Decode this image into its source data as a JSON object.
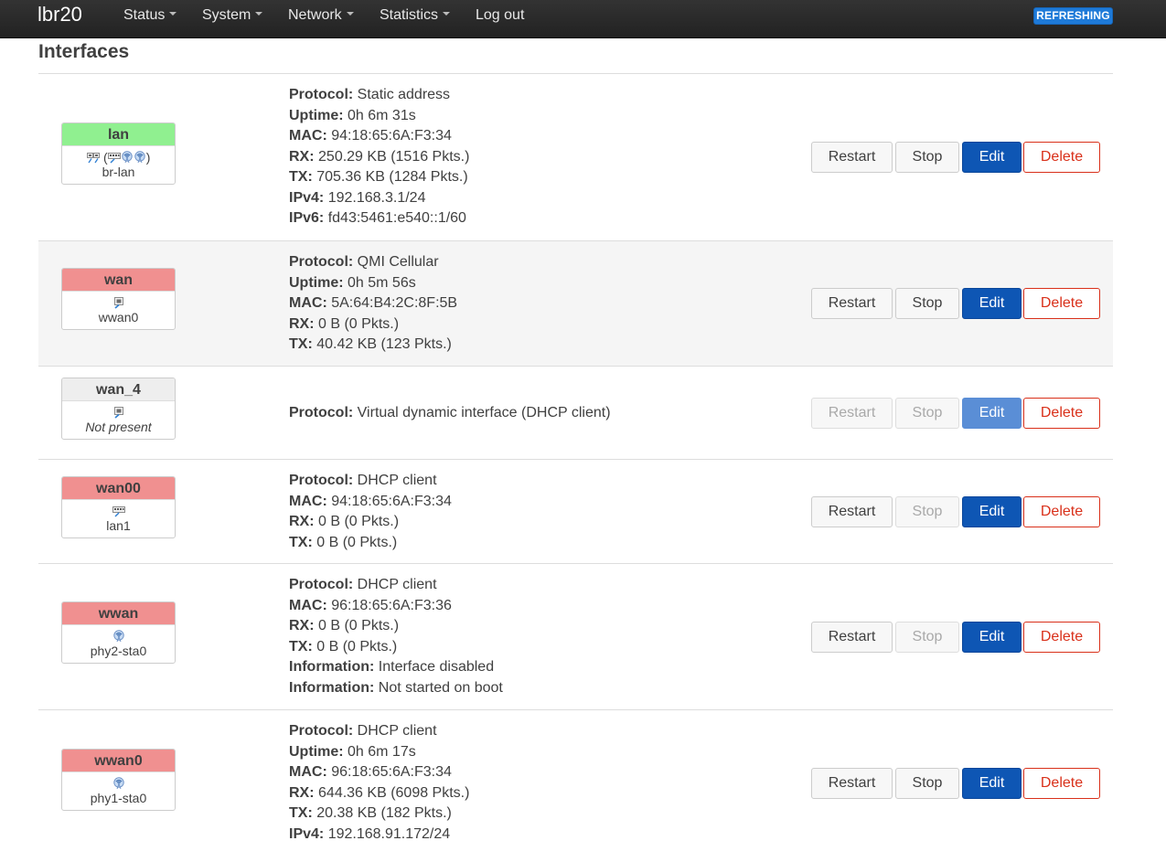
{
  "navbar": {
    "brand": "lbr20",
    "menu": [
      {
        "label": "Status",
        "dropdown": true
      },
      {
        "label": "System",
        "dropdown": true
      },
      {
        "label": "Network",
        "dropdown": true
      },
      {
        "label": "Statistics",
        "dropdown": true
      },
      {
        "label": "Log out",
        "dropdown": false
      }
    ],
    "refresh_badge": "REFRESHING"
  },
  "page": {
    "title": "Interfaces"
  },
  "colors": {
    "up": "#90f090",
    "down": "#f09090",
    "absent": "#eeeeee",
    "primary": "#0e56b4",
    "danger": "#d9301a"
  },
  "buttons": {
    "restart": "Restart",
    "stop": "Stop",
    "edit": "Edit",
    "delete": "Delete"
  },
  "interfaces": [
    {
      "name": "lan",
      "status": "up",
      "device": "br-lan",
      "icons": [
        "bridge-icon",
        "ethernet-switch-icon",
        "wifi-icon",
        "wifi-icon"
      ],
      "details": [
        {
          "label": "Protocol:",
          "value": "Static address"
        },
        {
          "label": "Uptime:",
          "value": "0h 6m 31s"
        },
        {
          "label": "MAC:",
          "value": "94:18:65:6A:F3:34"
        },
        {
          "label": "RX:",
          "value": "250.29 KB (1516 Pkts.)"
        },
        {
          "label": "TX:",
          "value": "705.36 KB (1284 Pkts.)"
        },
        {
          "label": "IPv4:",
          "value": "192.168.3.1/24"
        },
        {
          "label": "IPv6:",
          "value": "fd43:5461:e540::1/60"
        }
      ],
      "stop_enabled": true,
      "restart_enabled": true,
      "edit_enabled": true
    },
    {
      "name": "wan",
      "status": "down",
      "device": "wwan0",
      "icons": [
        "ethernet-port-icon"
      ],
      "details": [
        {
          "label": "Protocol:",
          "value": "QMI Cellular"
        },
        {
          "label": "Uptime:",
          "value": "0h 5m 56s"
        },
        {
          "label": "MAC:",
          "value": "5A:64:B4:2C:8F:5B"
        },
        {
          "label": "RX:",
          "value": "0 B (0 Pkts.)"
        },
        {
          "label": "TX:",
          "value": "40.42 KB (123 Pkts.)"
        }
      ],
      "stop_enabled": true,
      "restart_enabled": true,
      "edit_enabled": true
    },
    {
      "name": "wan_4",
      "status": "absent",
      "device": "Not present",
      "icons": [
        "ethernet-port-icon"
      ],
      "details": [
        {
          "label": "Protocol:",
          "value": "Virtual dynamic interface (DHCP client)"
        }
      ],
      "stop_enabled": false,
      "restart_enabled": false,
      "edit_enabled": false
    },
    {
      "name": "wan00",
      "status": "down",
      "device": "lan1",
      "icons": [
        "ethernet-switch-icon"
      ],
      "details": [
        {
          "label": "Protocol:",
          "value": "DHCP client"
        },
        {
          "label": "MAC:",
          "value": "94:18:65:6A:F3:34"
        },
        {
          "label": "RX:",
          "value": "0 B (0 Pkts.)"
        },
        {
          "label": "TX:",
          "value": "0 B (0 Pkts.)"
        }
      ],
      "stop_enabled": false,
      "restart_enabled": true,
      "edit_enabled": true
    },
    {
      "name": "wwan",
      "status": "down",
      "device": "phy2-sta0",
      "icons": [
        "wifi-icon"
      ],
      "details": [
        {
          "label": "Protocol:",
          "value": "DHCP client"
        },
        {
          "label": "MAC:",
          "value": "96:18:65:6A:F3:36"
        },
        {
          "label": "RX:",
          "value": "0 B (0 Pkts.)"
        },
        {
          "label": "TX:",
          "value": "0 B (0 Pkts.)"
        },
        {
          "label": "Information:",
          "value": "Interface disabled"
        },
        {
          "label": "Information:",
          "value": "Not started on boot"
        }
      ],
      "stop_enabled": false,
      "restart_enabled": true,
      "edit_enabled": true
    },
    {
      "name": "wwan0",
      "status": "down",
      "device": "phy1-sta0",
      "icons": [
        "wifi-icon"
      ],
      "details": [
        {
          "label": "Protocol:",
          "value": "DHCP client"
        },
        {
          "label": "Uptime:",
          "value": "0h 6m 17s"
        },
        {
          "label": "MAC:",
          "value": "96:18:65:6A:F3:34"
        },
        {
          "label": "RX:",
          "value": "644.36 KB (6098 Pkts.)"
        },
        {
          "label": "TX:",
          "value": "20.38 KB (182 Pkts.)"
        },
        {
          "label": "IPv4:",
          "value": "192.168.91.172/24"
        }
      ],
      "stop_enabled": true,
      "restart_enabled": true,
      "edit_enabled": true
    }
  ]
}
